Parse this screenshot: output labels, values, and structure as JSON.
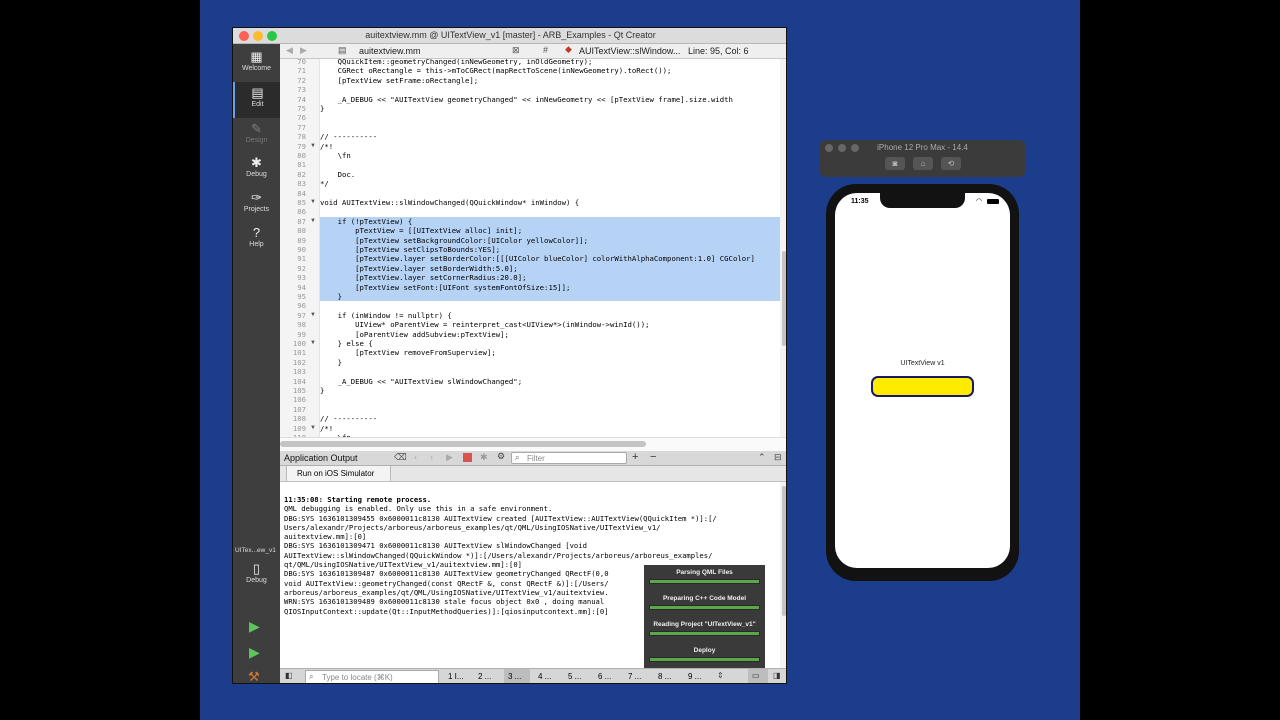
{
  "window": {
    "title": "auitextview.mm @ UITextView_v1 [master] - ARB_Examples - Qt Creator"
  },
  "editor_toolbar": {
    "file": "auitextview.mm",
    "symbol": "AUITextView::slWindow...",
    "position": "Line: 95, Col: 6"
  },
  "modes": [
    {
      "label": "Welcome",
      "icon": "grid-icon"
    },
    {
      "label": "Edit",
      "icon": "document-icon"
    },
    {
      "label": "Design",
      "icon": "pencil-icon"
    },
    {
      "label": "Debug",
      "icon": "bug-icon"
    },
    {
      "label": "Projects",
      "icon": "wrench-icon"
    },
    {
      "label": "Help",
      "icon": "help-icon"
    }
  ],
  "kit": {
    "label": "UITex...ew_v1",
    "mode": "Debug"
  },
  "code_lines": [
    {
      "n": "70",
      "t": "    QQuickItem::geometryChanged(inNewGeometry, inOldGeometry);",
      "f": ""
    },
    {
      "n": "71",
      "t": "    CGRect oRectangle = this->mToCGRect(mapRectToScene(inNewGeometry).toRect());",
      "f": ""
    },
    {
      "n": "72",
      "t": "    [pTextView setFrame:oRectangle];",
      "f": ""
    },
    {
      "n": "73",
      "t": "",
      "f": ""
    },
    {
      "n": "74",
      "t": "    _A_DEBUG << \"AUITextView geometryChanged\" << inNewGeometry << [pTextView frame].size.width",
      "f": ""
    },
    {
      "n": "75",
      "t": "}",
      "f": ""
    },
    {
      "n": "76",
      "t": "",
      "f": ""
    },
    {
      "n": "77",
      "t": "",
      "f": ""
    },
    {
      "n": "78",
      "t": "// ----------",
      "f": ""
    },
    {
      "n": "79",
      "t": "/*!",
      "f": "▼"
    },
    {
      "n": "80",
      "t": "    \\fn",
      "f": ""
    },
    {
      "n": "81",
      "t": "",
      "f": ""
    },
    {
      "n": "82",
      "t": "    Doc.",
      "f": ""
    },
    {
      "n": "83",
      "t": "*/",
      "f": ""
    },
    {
      "n": "84",
      "t": "",
      "f": ""
    },
    {
      "n": "85",
      "t": "void AUITextView::slWindowChanged(QQuickWindow* inWindow) {",
      "f": "▼"
    },
    {
      "n": "86",
      "t": "",
      "f": ""
    },
    {
      "n": "87",
      "t": "    if (!pTextView) {",
      "f": "▼",
      "s": 1
    },
    {
      "n": "88",
      "t": "        pTextView = [[UITextView alloc] init];",
      "f": "",
      "s": 1
    },
    {
      "n": "89",
      "t": "        [pTextView setBackgroundColor:[UIColor yellowColor]];",
      "f": "",
      "s": 1
    },
    {
      "n": "90",
      "t": "        [pTextView setClipsToBounds:YES];",
      "f": "",
      "s": 1
    },
    {
      "n": "91",
      "t": "        [pTextView.layer setBorderColor:[[[UIColor blueColor] colorWithAlphaComponent:1.0] CGColor]",
      "f": "",
      "s": 1
    },
    {
      "n": "92",
      "t": "        [pTextView.layer setBorderWidth:5.0];",
      "f": "",
      "s": 1
    },
    {
      "n": "93",
      "t": "        [pTextView.layer setCornerRadius:20.0];",
      "f": "",
      "s": 1
    },
    {
      "n": "94",
      "t": "        [pTextView setFont:[UIFont systemFontOfSize:15]];",
      "f": "",
      "s": 1
    },
    {
      "n": "95",
      "t": "    }",
      "f": "",
      "s": 1
    },
    {
      "n": "96",
      "t": "",
      "f": ""
    },
    {
      "n": "97",
      "t": "    if (inWindow != nullptr) {",
      "f": "▼"
    },
    {
      "n": "98",
      "t": "        UIView* oParentView = reinterpret_cast<UIView*>(inWindow->winId());",
      "f": ""
    },
    {
      "n": "99",
      "t": "        [oParentView addSubview:pTextView];",
      "f": ""
    },
    {
      "n": "100",
      "t": "    } else {",
      "f": "▼"
    },
    {
      "n": "101",
      "t": "        [pTextView removeFromSuperview];",
      "f": ""
    },
    {
      "n": "102",
      "t": "    }",
      "f": ""
    },
    {
      "n": "103",
      "t": "",
      "f": ""
    },
    {
      "n": "104",
      "t": "    _A_DEBUG << \"AUITextView slWindowChanged\";",
      "f": ""
    },
    {
      "n": "105",
      "t": "}",
      "f": ""
    },
    {
      "n": "106",
      "t": "",
      "f": ""
    },
    {
      "n": "107",
      "t": "",
      "f": ""
    },
    {
      "n": "108",
      "t": "// ----------",
      "f": ""
    },
    {
      "n": "109",
      "t": "/*!",
      "f": "▼"
    },
    {
      "n": "110",
      "t": "    \\fn",
      "f": ""
    }
  ],
  "output": {
    "title": "Application Output",
    "filter_placeholder": "Filter",
    "tab": "Run on iOS Simulator",
    "lines": [
      "11:35:08: Starting remote process.",
      "QML debugging is enabled. Only use this in a safe environment.",
      "DBG:SYS 1636101309455 0x6000011c8130 AUITextView created [AUITextView::AUITextView(QQuickItem *)]:[/",
      "Users/alexandr/Projects/arboreus/arboreus_examples/qt/QML/UsingIOSNative/UITextView_v1/",
      "auitextview.mm]:[0]",
      "DBG:SYS 1636101309471 0x6000011c8130 AUITextView slWindowChanged [void",
      "AUITextView::slWindowChanged(QQuickWindow *)]:[/Users/alexandr/Projects/arboreus/arboreus_examples/",
      "qt/QML/UsingIOSNative/UITextView_v1/auitextview.mm]:[0]",
      "DBG:SYS 1636101309487 0x6000011c8130 AUITextView geometryChanged QRectF(0,0",
      "void AUITextView::geometryChanged(const QRectF &, const QRectF &)]:[/Users/",
      "arboreus/arboreus_examples/qt/QML/UsingIOSNative/UITextView_v1/auitextview.",
      "WRN:SYS 1636101309489 0x6000011c8130 stale focus object 0x0 , doing manual",
      "QIOSInputContext::update(Qt::InputMethodQueries)]:[qiosinputcontext.mm]:[0]"
    ]
  },
  "progress": [
    {
      "label": "Parsing QML Files"
    },
    {
      "label": "Preparing C++ Code Model"
    },
    {
      "label": "Reading Project \"UITextView_v1\""
    },
    {
      "label": "Deploy"
    }
  ],
  "statusbar": {
    "locate_placeholder": "Type to locate (⌘K)",
    "panes": [
      "1 I...",
      "2 ...",
      "3 ...",
      "4 ...",
      "5 ...",
      "6 ...",
      "7 ...",
      "8 ...",
      "9 ..."
    ]
  },
  "simulator": {
    "title": "iPhone 12 Pro Max - 14.4",
    "time": "11:35",
    "app_label": "UITextView v1"
  },
  "colors": {
    "desktop": "#1c3c8c",
    "selection": "#b6d3f5",
    "text_view_fill": "#ffeb00",
    "text_view_border": "#1a1a5c"
  }
}
